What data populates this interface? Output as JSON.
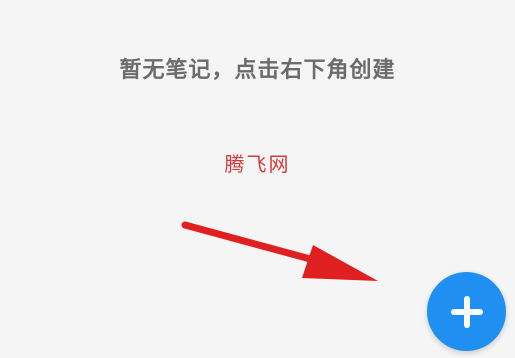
{
  "empty_state": {
    "message": "暂无笔记，点击右下角创建"
  },
  "watermark": {
    "text": "腾飞网"
  },
  "add_button": {
    "icon": "plus-icon",
    "color": "#1f8ff2"
  },
  "annotation": {
    "arrow_color": "#e02020"
  }
}
